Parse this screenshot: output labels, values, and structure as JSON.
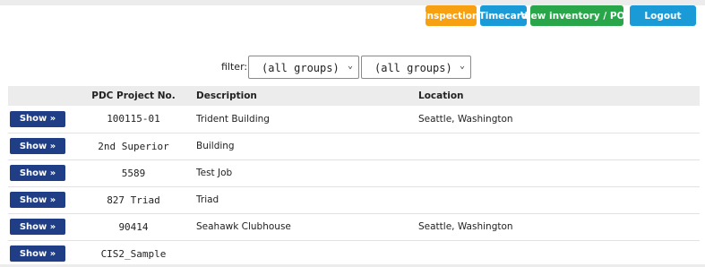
{
  "nav": {
    "inspection": "Inspection",
    "timecard": "Timecard",
    "inventory": "View inventory / PO's",
    "logout": "Logout"
  },
  "filter": {
    "label": "filter:",
    "group1": "(all groups)",
    "group2": "(all groups)"
  },
  "table": {
    "headers": {
      "project_no": "PDC Project No.",
      "description": "Description",
      "location": "Location"
    },
    "show_label": "Show »",
    "rows": [
      {
        "project_no": "100115-01",
        "description": "Trident Building",
        "location": "Seattle, Washington"
      },
      {
        "project_no": "2nd Superior",
        "description": "Building",
        "location": ""
      },
      {
        "project_no": "5589",
        "description": "Test Job",
        "location": ""
      },
      {
        "project_no": "827 Triad",
        "description": "Triad",
        "location": ""
      },
      {
        "project_no": "90414",
        "description": "Seahawk Clubhouse",
        "location": "Seattle, Washington"
      },
      {
        "project_no": "CIS2_Sample",
        "description": "",
        "location": ""
      }
    ]
  },
  "colors": {
    "inspection": "#f7a012",
    "timecard": "#1a9bd7",
    "inventory": "#2aa64a",
    "logout": "#1a9bd7",
    "show_button": "#1f3e86"
  }
}
